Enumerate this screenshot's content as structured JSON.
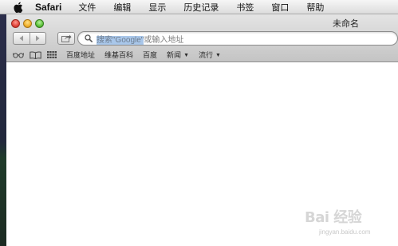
{
  "menubar": {
    "app_name": "Safari",
    "items": [
      "文件",
      "编辑",
      "显示",
      "历史记录",
      "书签",
      "窗口",
      "帮助"
    ]
  },
  "window": {
    "title": "未命名"
  },
  "toolbar": {
    "search_highlight": "搜索\"Google\"",
    "search_rest": "或输入地址"
  },
  "bookmarks": {
    "items": [
      "百度地址",
      "维基百科",
      "百度",
      "新闻",
      "流行"
    ],
    "dropdown_items": [
      "新闻",
      "流行"
    ]
  },
  "watermark": {
    "logo": "Bai 经验",
    "url": "jingyan.baidu.com"
  },
  "colors": {
    "traffic_close": "#e0433a",
    "traffic_minimize": "#f0b02a",
    "traffic_zoom": "#5cc23a",
    "address_highlight": "#a9c7ea"
  }
}
